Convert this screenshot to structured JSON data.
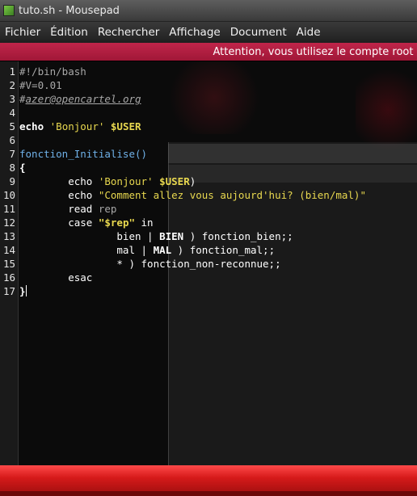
{
  "window": {
    "title": "tuto.sh - Mousepad"
  },
  "menu": [
    "Fichier",
    "Édition",
    "Rechercher",
    "Affichage",
    "Document",
    "Aide"
  ],
  "warning": "Attention, vous utilisez le compte root ;",
  "editor": {
    "line_numbers": [
      "1",
      "2",
      "3",
      "4",
      "5",
      "6",
      "7",
      "8",
      "9",
      "10",
      "11",
      "12",
      "13",
      "14",
      "15",
      "16",
      "17"
    ],
    "lines": [
      [
        {
          "t": "#!/bin/bash",
          "c": "comment"
        }
      ],
      [
        {
          "t": "#V=0.01",
          "c": "comment"
        }
      ],
      [
        {
          "t": "#",
          "c": "comment"
        },
        {
          "t": "azer@opencartel.org",
          "c": "link"
        }
      ],
      [],
      [
        {
          "t": "echo",
          "c": "kw"
        },
        {
          "t": " ",
          "c": "plain"
        },
        {
          "t": "'Bonjour'",
          "c": "str"
        },
        {
          "t": " ",
          "c": "plain"
        },
        {
          "t": "$USER",
          "c": "var"
        }
      ],
      [],
      [
        {
          "t": "fonction_Initialise()",
          "c": "fn"
        }
      ],
      [
        {
          "t": "{",
          "c": "bold"
        }
      ],
      [
        {
          "t": "        echo ",
          "c": "plain"
        },
        {
          "t": "'Bonjour'",
          "c": "str"
        },
        {
          "t": " ",
          "c": "plain"
        },
        {
          "t": "$USER",
          "c": "var"
        },
        {
          "t": ")",
          "c": "plain"
        }
      ],
      [
        {
          "t": "        echo ",
          "c": "plain"
        },
        {
          "t": "\"Comment allez vous aujourd'hui? (bien/mal)\"",
          "c": "str"
        }
      ],
      [
        {
          "t": "        read ",
          "c": "plain"
        },
        {
          "t": "rep",
          "c": "comment"
        }
      ],
      [
        {
          "t": "        case ",
          "c": "plain"
        },
        {
          "t": "\"$rep\"",
          "c": "var"
        },
        {
          "t": " in",
          "c": "plain"
        }
      ],
      [
        {
          "t": "                bien | ",
          "c": "plain"
        },
        {
          "t": "BIEN",
          "c": "bold"
        },
        {
          "t": " ) fonction_bien;;",
          "c": "plain"
        }
      ],
      [
        {
          "t": "                mal | ",
          "c": "plain"
        },
        {
          "t": "MAL",
          "c": "bold"
        },
        {
          "t": " ) fonction_mal;;",
          "c": "plain"
        }
      ],
      [
        {
          "t": "                * ) fonction_non-reconnue;;",
          "c": "plain"
        }
      ],
      [
        {
          "t": "        esac",
          "c": "plain"
        }
      ],
      [
        {
          "t": "}",
          "c": "bold"
        }
      ]
    ]
  }
}
